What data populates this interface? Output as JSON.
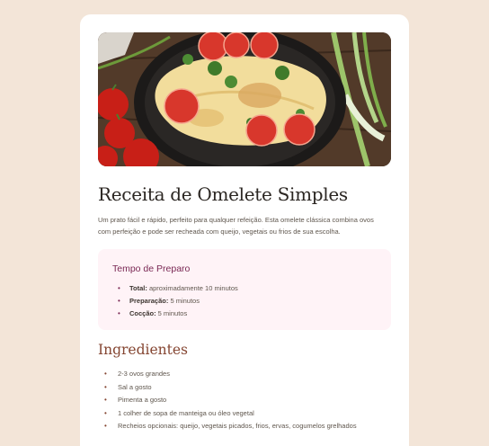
{
  "recipe": {
    "title": "Receita de Omelete Simples",
    "intro": "Um prato fácil e rápido, perfeito para qualquer refeição. Esta omelete clássica combina ovos com perfeição e pode ser recheada com queijo, vegetais ou frios de sua escolha."
  },
  "prep": {
    "heading": "Tempo de Preparo",
    "items": [
      {
        "label": "Total:",
        "value": " aproximadamente 10 minutos"
      },
      {
        "label": "Preparação:",
        "value": " 5 minutos"
      },
      {
        "label": "Cocção:",
        "value": " 5 minutos"
      }
    ]
  },
  "ingredients": {
    "heading": "Ingredientes",
    "items": [
      "2-3 ovos grandes",
      "Sal a gosto",
      "Pimenta a gosto",
      "1 colher de sopa de manteiga ou óleo vegetal",
      "Recheios opcionais: queijo, vegetais picados, frios, ervas, cogumelos grelhados"
    ]
  },
  "colors": {
    "page_bg": "#f3e5d8",
    "card_bg": "#ffffff",
    "title": "#2b2622",
    "accent_prep": "#7a2854",
    "prep_bg": "#fff3f7",
    "accent_ingredients": "#854632"
  },
  "hero_image": {
    "icon": "omelette-photo"
  }
}
